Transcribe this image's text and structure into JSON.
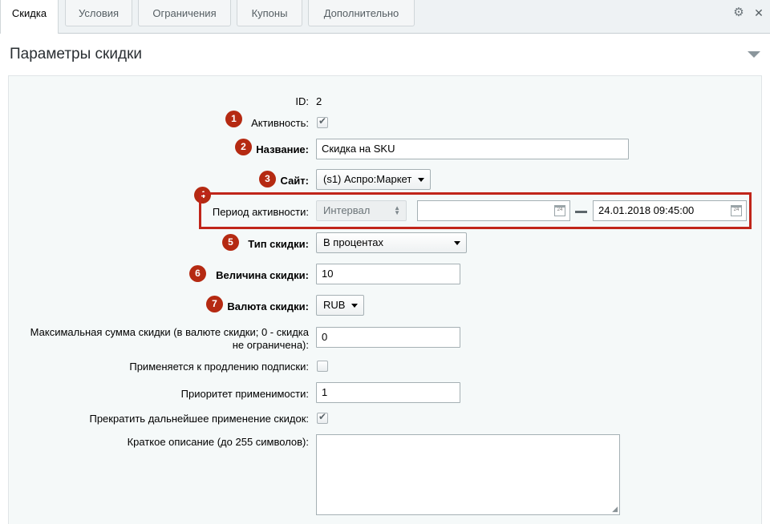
{
  "tabs": [
    {
      "label": "Скидка",
      "active": true
    },
    {
      "label": "Условия",
      "active": false
    },
    {
      "label": "Ограничения",
      "active": false
    },
    {
      "label": "Купоны",
      "active": false
    },
    {
      "label": "Дополнительно",
      "active": false
    }
  ],
  "section": {
    "title": "Параметры скидки"
  },
  "form": {
    "id": {
      "label": "ID:",
      "value": "2"
    },
    "active": {
      "label": "Активность:",
      "checked": true
    },
    "name": {
      "label": "Название:",
      "value": "Скидка на SKU"
    },
    "site": {
      "label": "Сайт:",
      "value": "(s1) Аспро:Маркет"
    },
    "period": {
      "label": "Период активности:",
      "mode": "Интервал",
      "from": "",
      "to": "24.01.2018 09:45:00",
      "cal_day": "24"
    },
    "discount_type": {
      "label": "Тип скидки:",
      "value": "В процентах"
    },
    "discount_value": {
      "label": "Величина скидки:",
      "value": "10"
    },
    "currency": {
      "label": "Валюта скидки:",
      "value": "RUB"
    },
    "max_sum": {
      "label_line1": "Максимальная сумма скидки (в валюте скидки; 0 - скидка",
      "label_line2": "не ограничена):",
      "value": "0"
    },
    "renewal": {
      "label": "Применяется к продлению подписки:",
      "checked": false
    },
    "priority": {
      "label": "Приоритет применимости:",
      "value": "1"
    },
    "stop_further": {
      "label": "Прекратить дальнейшее применение скидок:",
      "checked": true
    },
    "description": {
      "label": "Краткое описание (до 255 символов):",
      "value": ""
    }
  },
  "badges": [
    "1",
    "2",
    "3",
    "4",
    "5",
    "6",
    "7"
  ],
  "colors": {
    "badge": "#b52a12",
    "highlight": "#c0251a"
  },
  "icons": {
    "settings": "gear-icon",
    "collapse": "chevron-down-icon",
    "calendar": "calendar-icon"
  }
}
